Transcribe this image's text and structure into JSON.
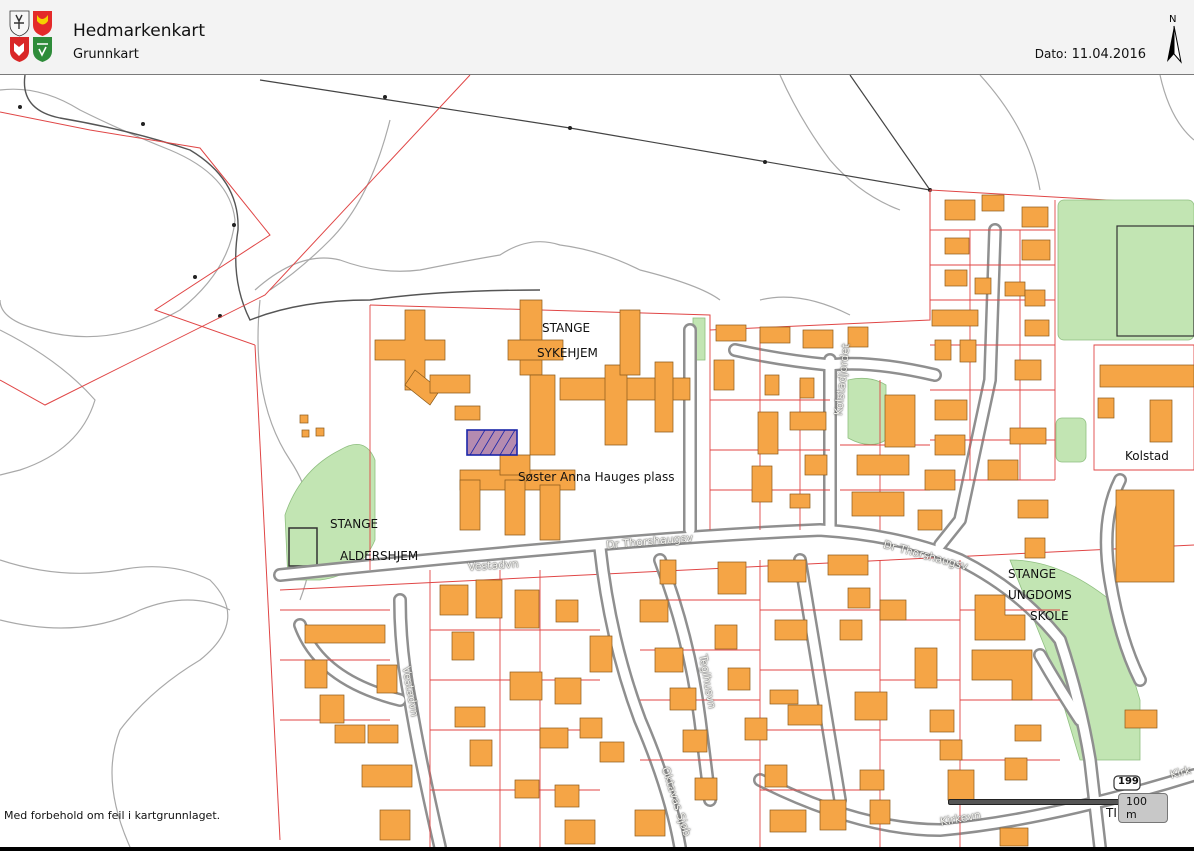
{
  "header": {
    "title": "Hedmarkenkart",
    "subtitle": "Grunnkart",
    "date_label": "Dato:",
    "date_value": "11.04.2016",
    "north_letter": "N"
  },
  "footer": {
    "disclaimer": "Med forbehold om feil i kartgrunnlaget.",
    "scale_label": "100 m"
  },
  "map_labels": {
    "sykehjem_1": "STANGE",
    "sykehjem_2": "SYKEHJEM",
    "plass": "Søster Anna Hauges plass",
    "aldershjem_1": "STANGE",
    "aldershjem_2": "ALDERSHJEM",
    "skole_1": "STANGE",
    "skole_2": "UNGDOMS",
    "skole_3": "SKOLE",
    "kolstad": "Kolstad",
    "tingvoll": "TINGVOLL",
    "road_number": "199"
  },
  "street_labels": {
    "vestadvn_1": "Vestadvn",
    "vestadvn_2": "Vestadvn",
    "thorshaug_1": "Dr Thorshaugsv",
    "thorshaug_2": "Dr Thorshaugsv",
    "kolstadjordet": "Kolstadjordet",
    "teglhusvn": "Teglhusvn",
    "oktavas": "Oktavas Sjøb",
    "kirkevn": "Kirkevn",
    "kirk_right": "Kirk"
  },
  "colors": {
    "building": "#f5a546",
    "building_stroke": "#8a5a1a",
    "parcel": "#e04646",
    "road_fill": "#ffffff",
    "road_edge": "#9a9a9a",
    "green": "#bfe3b0",
    "contour": "#9a9a9a"
  }
}
